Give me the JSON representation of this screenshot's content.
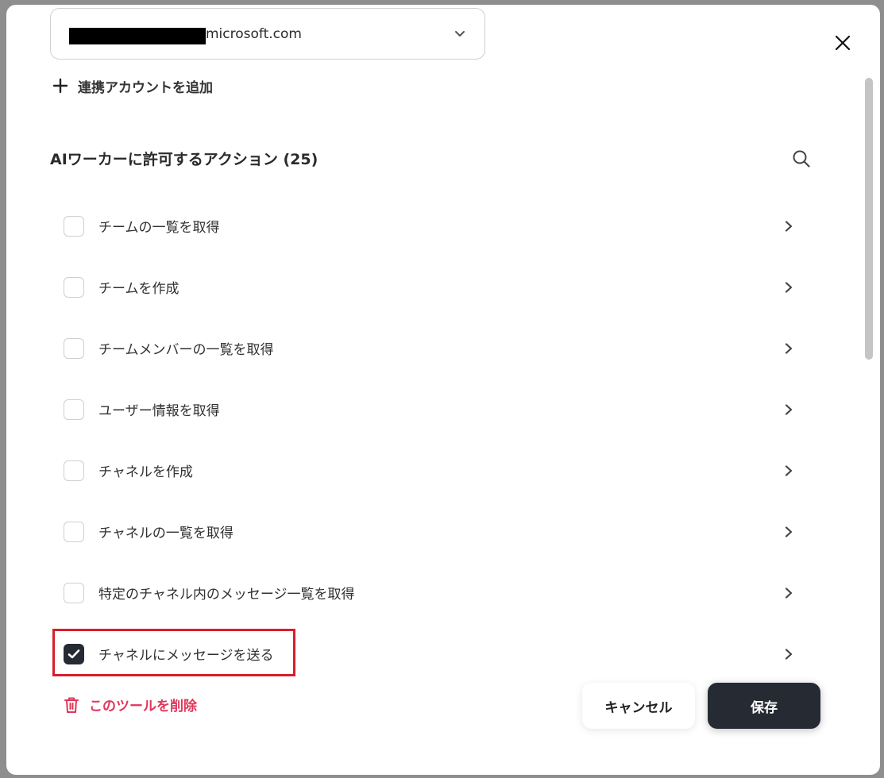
{
  "account": {
    "domain": "microsoft.com"
  },
  "add_account_label": "連携アカウントを追加",
  "section_title": "AIワーカーに許可するアクション (25)",
  "actions": [
    {
      "label": "チームの一覧を取得",
      "checked": false
    },
    {
      "label": "チームを作成",
      "checked": false
    },
    {
      "label": "チームメンバーの一覧を取得",
      "checked": false
    },
    {
      "label": "ユーザー情報を取得",
      "checked": false
    },
    {
      "label": "チャネルを作成",
      "checked": false
    },
    {
      "label": "チャネルの一覧を取得",
      "checked": false
    },
    {
      "label": "特定のチャネル内のメッセージ一覧を取得",
      "checked": false
    },
    {
      "label": "チャネルにメッセージを送る",
      "checked": true
    }
  ],
  "delete_tool_label": "このツールを削除",
  "buttons": {
    "cancel": "キャンセル",
    "save": "保存"
  },
  "colors": {
    "primary_dark": "#262a33",
    "delete_pink": "#e0365a",
    "highlight_red": "#d81e2a"
  },
  "icons": [
    "chevron-down-icon",
    "close-icon",
    "plus-icon",
    "search-icon",
    "chevron-right-icon",
    "check-icon",
    "trash-icon"
  ]
}
